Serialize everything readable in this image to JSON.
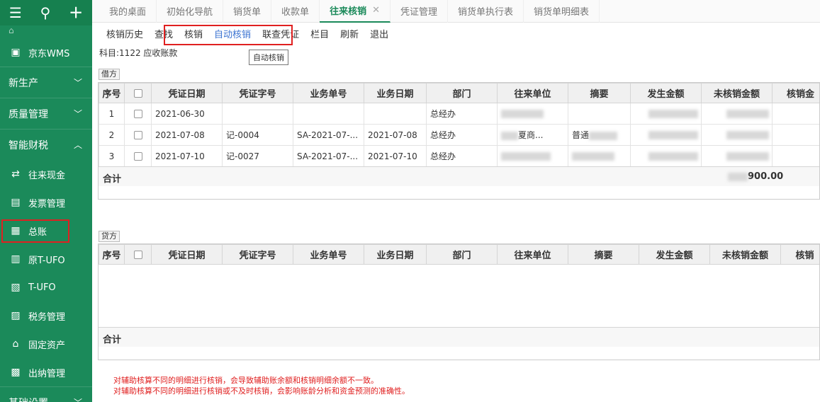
{
  "sidebar": {
    "top_icons": [
      "menu-icon",
      "search-icon",
      "plus-icon"
    ],
    "items": [
      {
        "label": "京东WMS",
        "icon": "store-icon",
        "type": "item"
      },
      {
        "label": "新生产",
        "type": "group",
        "expanded": false
      },
      {
        "label": "质量管理",
        "type": "group",
        "expanded": false
      },
      {
        "label": "智能财税",
        "type": "group",
        "expanded": true
      },
      {
        "label": "往来现金",
        "icon": "flow-icon",
        "type": "item"
      },
      {
        "label": "发票管理",
        "icon": "invoice-icon",
        "type": "item"
      },
      {
        "label": "总账",
        "icon": "ledger-icon",
        "type": "item",
        "highlighted": true
      },
      {
        "label": "原T-UFO",
        "icon": "ufo-icon",
        "type": "item"
      },
      {
        "label": "T-UFO",
        "icon": "ufo-report-icon",
        "type": "item"
      },
      {
        "label": "税务管理",
        "icon": "tax-icon",
        "type": "item"
      },
      {
        "label": "固定资产",
        "icon": "bank-icon",
        "type": "item"
      },
      {
        "label": "出纳管理",
        "icon": "cashier-icon",
        "type": "item"
      },
      {
        "label": "基础设置",
        "type": "group",
        "expanded": false
      }
    ]
  },
  "tabs": [
    {
      "label": "我的桌面"
    },
    {
      "label": "初始化导航"
    },
    {
      "label": "销货单"
    },
    {
      "label": "收款单"
    },
    {
      "label": "往来核销",
      "active": true,
      "closable": true
    },
    {
      "label": "凭证管理"
    },
    {
      "label": "销货单执行表"
    },
    {
      "label": "销货单明细表"
    }
  ],
  "toolbar": {
    "items": [
      "核销历史",
      "查找",
      "核销",
      "自动核销",
      "联查凭证",
      "栏目",
      "刷新",
      "退出"
    ],
    "tooltip": "自动核销"
  },
  "subject": "科目:1122 应收账款",
  "debit": {
    "label": "借方",
    "columns": [
      "序号",
      "",
      "凭证日期",
      "凭证字号",
      "业务单号",
      "业务日期",
      "部门",
      "往来单位",
      "摘要",
      "发生金额",
      "未核销金额",
      "核销金"
    ],
    "rows": [
      {
        "no": "1",
        "date": "2021-06-30",
        "voucher": "",
        "bizno": "",
        "bizdate": "",
        "dept": "总经办"
      },
      {
        "no": "2",
        "date": "2021-07-08",
        "voucher": "记-0004",
        "bizno": "SA-2021-07-...",
        "bizdate": "2021-07-08",
        "dept": "总经办",
        "partner_tail": "夏商...",
        "summary_head": "普通"
      },
      {
        "no": "3",
        "date": "2021-07-10",
        "voucher": "记-0027",
        "bizno": "SA-2021-07-...",
        "bizdate": "2021-07-10",
        "dept": "总经办"
      }
    ],
    "total_label": "合计",
    "total_amount_visible": "900.00"
  },
  "credit": {
    "label": "贷方",
    "columns": [
      "序号",
      "",
      "凭证日期",
      "凭证字号",
      "业务单号",
      "业务日期",
      "部门",
      "往来单位",
      "摘要",
      "发生金额",
      "未核销金额",
      "核销"
    ],
    "total_label": "合计"
  },
  "notes": [
    "对辅助核算不同的明细进行核销，会导致辅助账余额和核销明细余额不一致。",
    "对辅助核算不同的明细进行核销或不及时核销，会影响账龄分析和资金预测的准确性。"
  ],
  "colors": {
    "sidebar": "#1b8a5a",
    "accent_link": "#3b73d1",
    "warning": "#e02020"
  }
}
